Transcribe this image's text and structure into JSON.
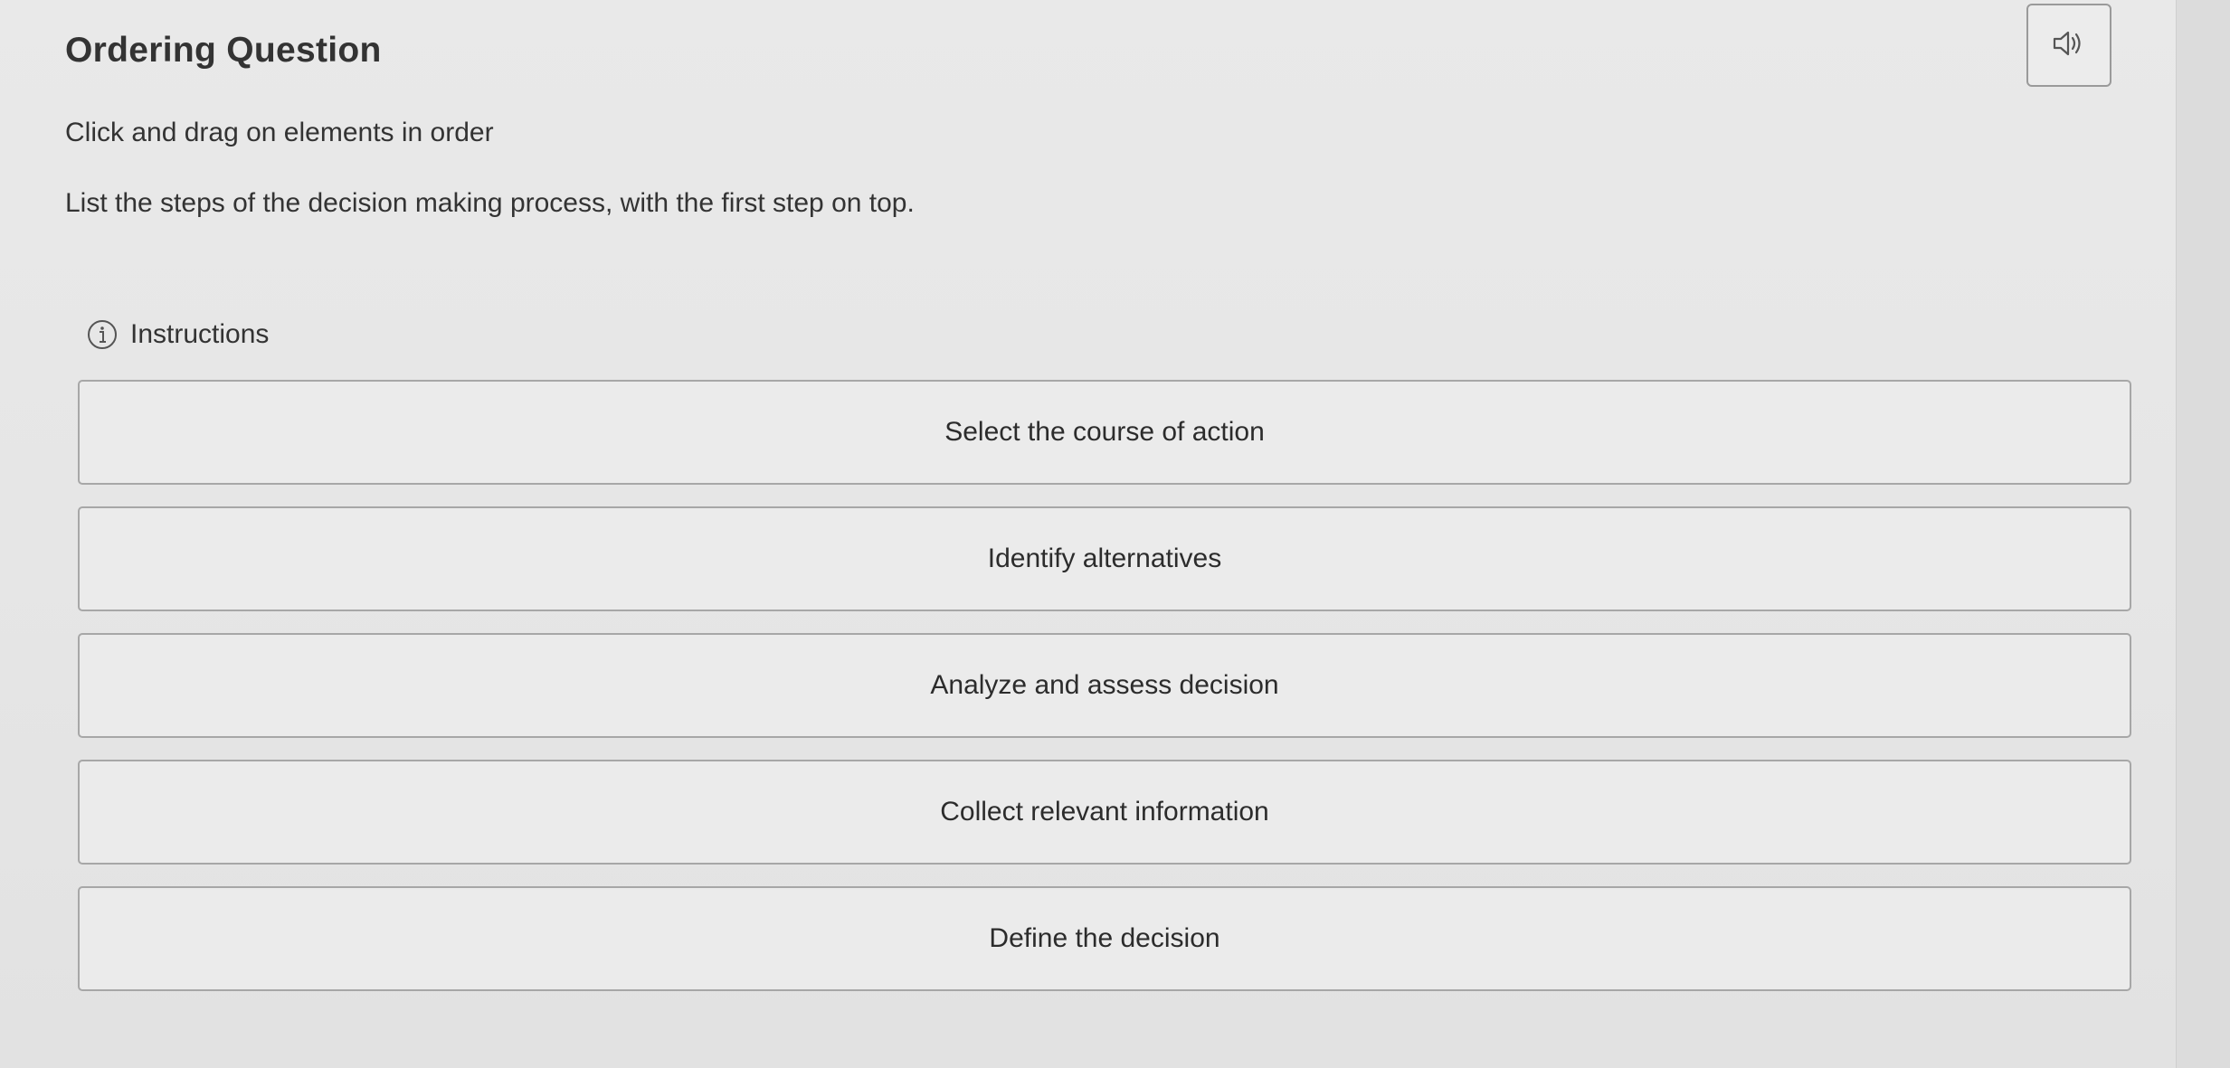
{
  "header": {
    "title": "Ordering Question",
    "audio_icon": "speaker-icon"
  },
  "question": {
    "prompt": "Click and drag on elements in order",
    "text": "List the steps of the decision making process, with the first step on top."
  },
  "instructions": {
    "icon": "info-icon",
    "label": "Instructions"
  },
  "items": [
    "Select the course of action",
    "Identify alternatives",
    "Analyze and assess decision",
    "Collect relevant information",
    "Define the decision"
  ]
}
